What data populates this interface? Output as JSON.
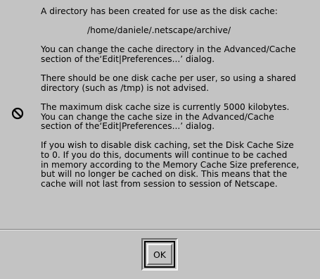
{
  "dialog": {
    "icon": "no-entry-icon",
    "messages": [
      "A directory has been created for use as the disk cache:",
      "/home/daniele/.netscape/archive/",
      "You can change the cache directory in the Advanced/Cache\nsection of the‘Edit|Preferences...’ dialog.",
      "There should be one disk cache per user, so using a shared\ndirectory (such as /tmp) is not advised.",
      "The maximum disk cache size is currently 5000 kilobytes.\nYou can change the cache size in the Advanced/Cache\nsection of the‘Edit|Preferences...’ dialog.",
      "If you wish to disable disk caching, set the Disk Cache Size\nto 0.  If you do this, documents will continue to be cached\nin memory according to the Memory Cache Size preference,\nbut will no longer be cached on disk.  This means that the\ncache will not last from session to session of Netscape."
    ],
    "ok_label": "OK"
  }
}
